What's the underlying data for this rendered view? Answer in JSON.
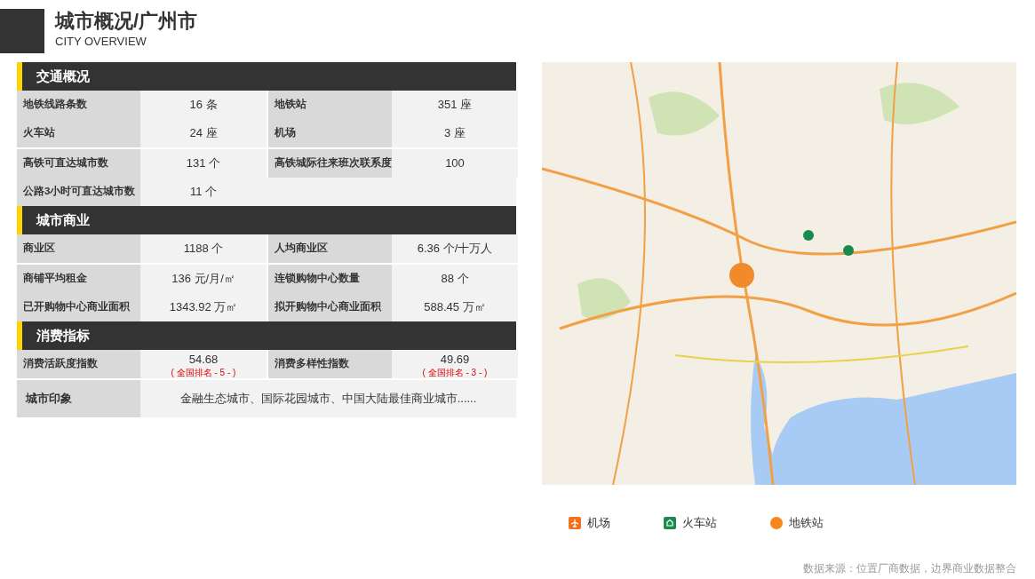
{
  "header": {
    "title": "城市概况/广州市",
    "subtitle": "CITY OVERVIEW"
  },
  "sections": [
    {
      "title": "交通概况",
      "groups": [
        [
          {
            "cells": [
              {
                "label": "地铁线路条数",
                "value": "16 条"
              },
              {
                "label": "地铁站",
                "value": "351 座"
              }
            ]
          },
          {
            "cells": [
              {
                "label": "火车站",
                "value": "24 座"
              },
              {
                "label": "机场",
                "value": "3 座"
              }
            ]
          }
        ],
        [
          {
            "cells": [
              {
                "label": "高铁可直达城市数",
                "value": "131 个"
              },
              {
                "label": "高铁城际往来班次联系度",
                "value": "100"
              }
            ]
          },
          {
            "cells": [
              {
                "label": "公路3小时可直达城市数",
                "value": "11 个"
              }
            ]
          }
        ]
      ]
    },
    {
      "title": "城市商业",
      "groups": [
        [
          {
            "cells": [
              {
                "label": "商业区",
                "value": "1188 个"
              },
              {
                "label": "人均商业区",
                "value": "6.36 个/十万人"
              }
            ]
          }
        ],
        [
          {
            "cells": [
              {
                "label": "商铺平均租金",
                "value": "136 元/月/㎡"
              },
              {
                "label": "连锁购物中心数量",
                "value": "88 个"
              }
            ]
          },
          {
            "cells": [
              {
                "label": "已开购物中心商业面积",
                "value": "1343.92 万㎡"
              },
              {
                "label": "拟开购物中心商业面积",
                "value": "588.45 万㎡"
              }
            ]
          }
        ]
      ]
    },
    {
      "title": "消费指标",
      "groups": [
        [
          {
            "cells": [
              {
                "label": "消费活跃度指数",
                "value": "54.68",
                "rank": "( 全国排名 - 5 - )"
              },
              {
                "label": "消费多样性指数",
                "value": "49.69",
                "rank": "( 全国排名 - 3 - )"
              }
            ]
          }
        ],
        [
          {
            "cells": [
              {
                "label": "城市印象",
                "value": "金融生态城市、国际花园城市、中国大陆最佳商业城市......",
                "wide": true
              }
            ]
          }
        ]
      ]
    }
  ],
  "legend": [
    {
      "kind": "airport",
      "label": "机场"
    },
    {
      "kind": "train",
      "label": "火车站"
    },
    {
      "kind": "metro",
      "label": "地铁站"
    }
  ],
  "source": "数据来源：位置厂商数据，边界商业数据整合"
}
